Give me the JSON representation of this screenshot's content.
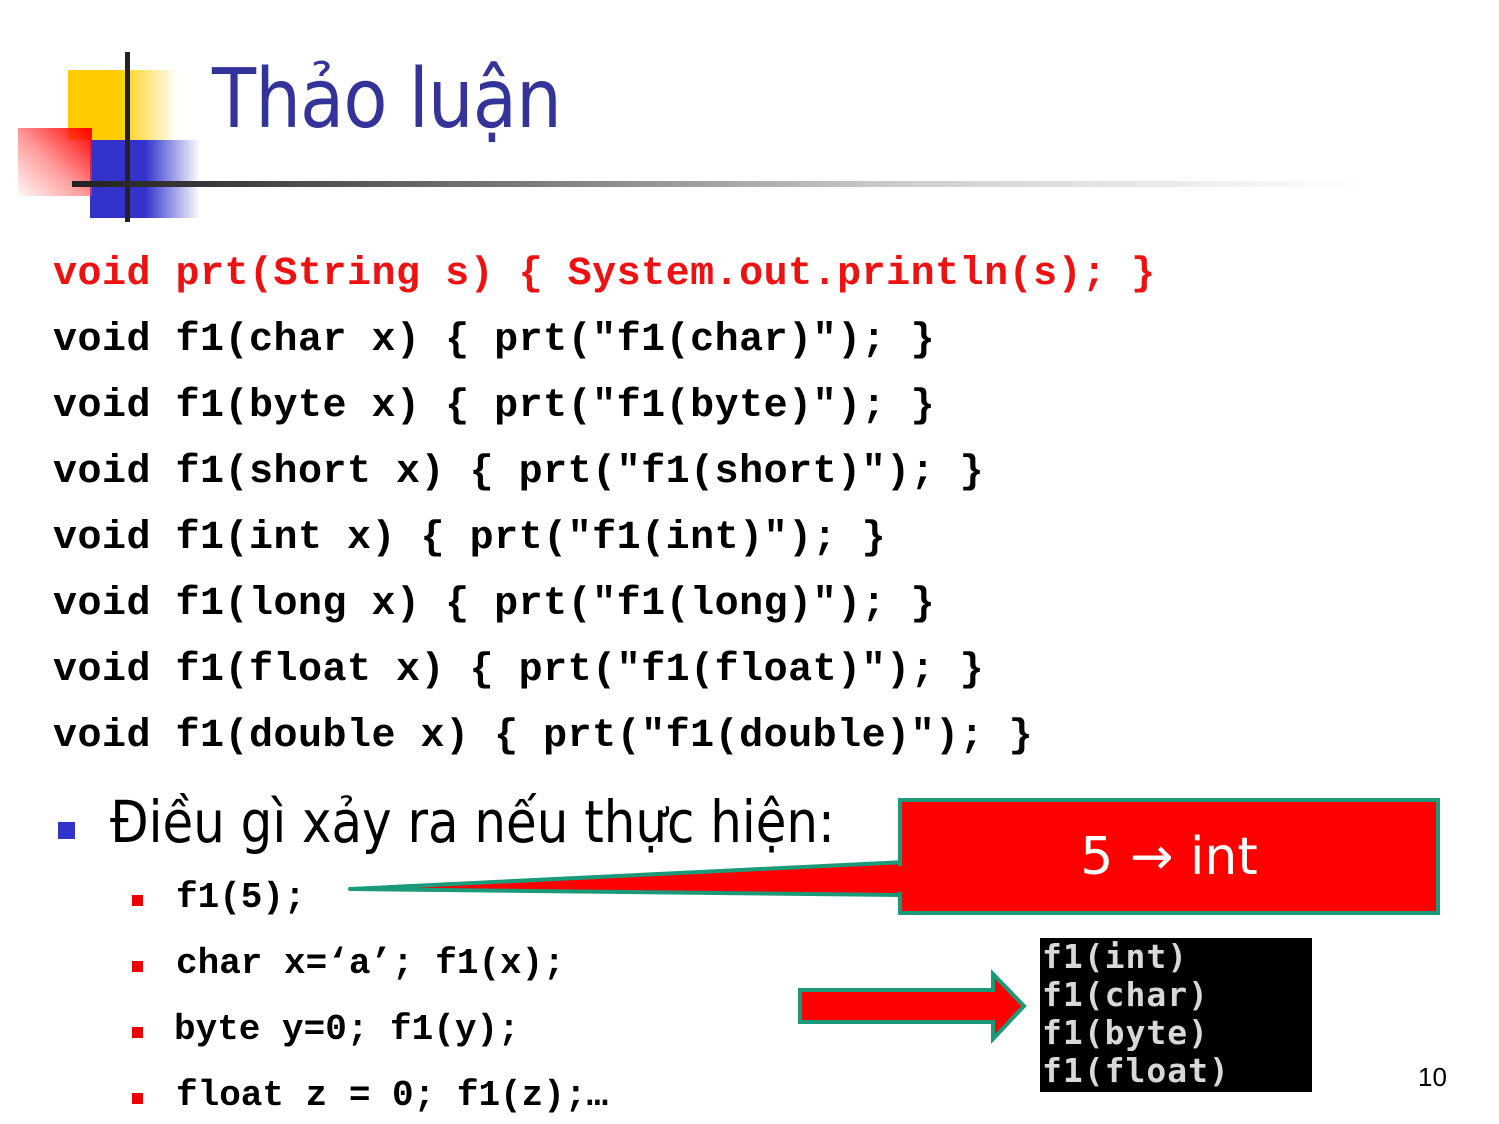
{
  "slide": {
    "title": "Thảo luận",
    "page_number": "10",
    "colors": {
      "title": "#333399",
      "code_highlight": "#ee1111",
      "callout_fill": "#ff0000",
      "callout_border": "#1a9a78",
      "bullet_primary": "#3333cc",
      "bullet_secondary": "#ee0000"
    }
  },
  "code_lines": [
    "void prt(String s) { System.out.println(s); }",
    "void f1(char x) { prt(\"f1(char)\"); }",
    "void f1(byte x) { prt(\"f1(byte)\"); }",
    "void f1(short x) { prt(\"f1(short)\"); }",
    "void f1(int x) { prt(\"f1(int)\"); }",
    "void f1(long x) { prt(\"f1(long)\"); }",
    "void f1(float x) { prt(\"f1(float)\"); }",
    "void f1(double x) { prt(\"f1(double)\"); }"
  ],
  "question": {
    "text": "Điều gì xảy ra nếu thực hiện:",
    "sub_items": [
      "f1(5);",
      "char x=‘a’; f1(x);",
      "byte y=0; f1(y);",
      "float z = 0; f1(z);…"
    ]
  },
  "callout": {
    "text": "5 → int"
  },
  "console_output": [
    "f1(int)",
    "f1(char)",
    "f1(byte)",
    "f1(float)"
  ]
}
